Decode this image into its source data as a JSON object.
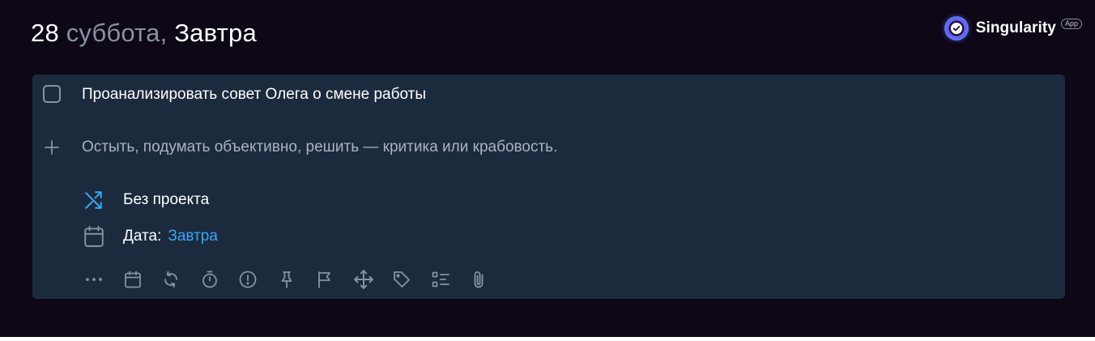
{
  "header": {
    "day_number": "28",
    "weekday": " суббота,",
    "relative": " Завтра"
  },
  "brand": {
    "name": "Singularity",
    "badge": "App",
    "logo_icon": "check-circle-icon"
  },
  "task": {
    "title": "Проанализировать совет Олега о смене работы",
    "note": "Остыть, подумать объективно, решить — критика или крабовость.",
    "project": {
      "icon": "shuffle-icon",
      "label": "Без проекта"
    },
    "date": {
      "icon": "calendar-icon",
      "label": "Дата:",
      "value": "Завтра"
    }
  },
  "toolbar": [
    {
      "name": "more-icon"
    },
    {
      "name": "calendar-icon"
    },
    {
      "name": "repeat-icon"
    },
    {
      "name": "timer-icon"
    },
    {
      "name": "priority-icon"
    },
    {
      "name": "pin-icon"
    },
    {
      "name": "flag-icon"
    },
    {
      "name": "move-icon"
    },
    {
      "name": "tag-icon"
    },
    {
      "name": "checklist-icon"
    },
    {
      "name": "attachment-icon"
    }
  ],
  "colors": {
    "background": "#0d0716",
    "card": "#1c2a3e",
    "accent": "#3aa6f5",
    "muted": "#8a90a3",
    "icon": "#8593a6"
  }
}
